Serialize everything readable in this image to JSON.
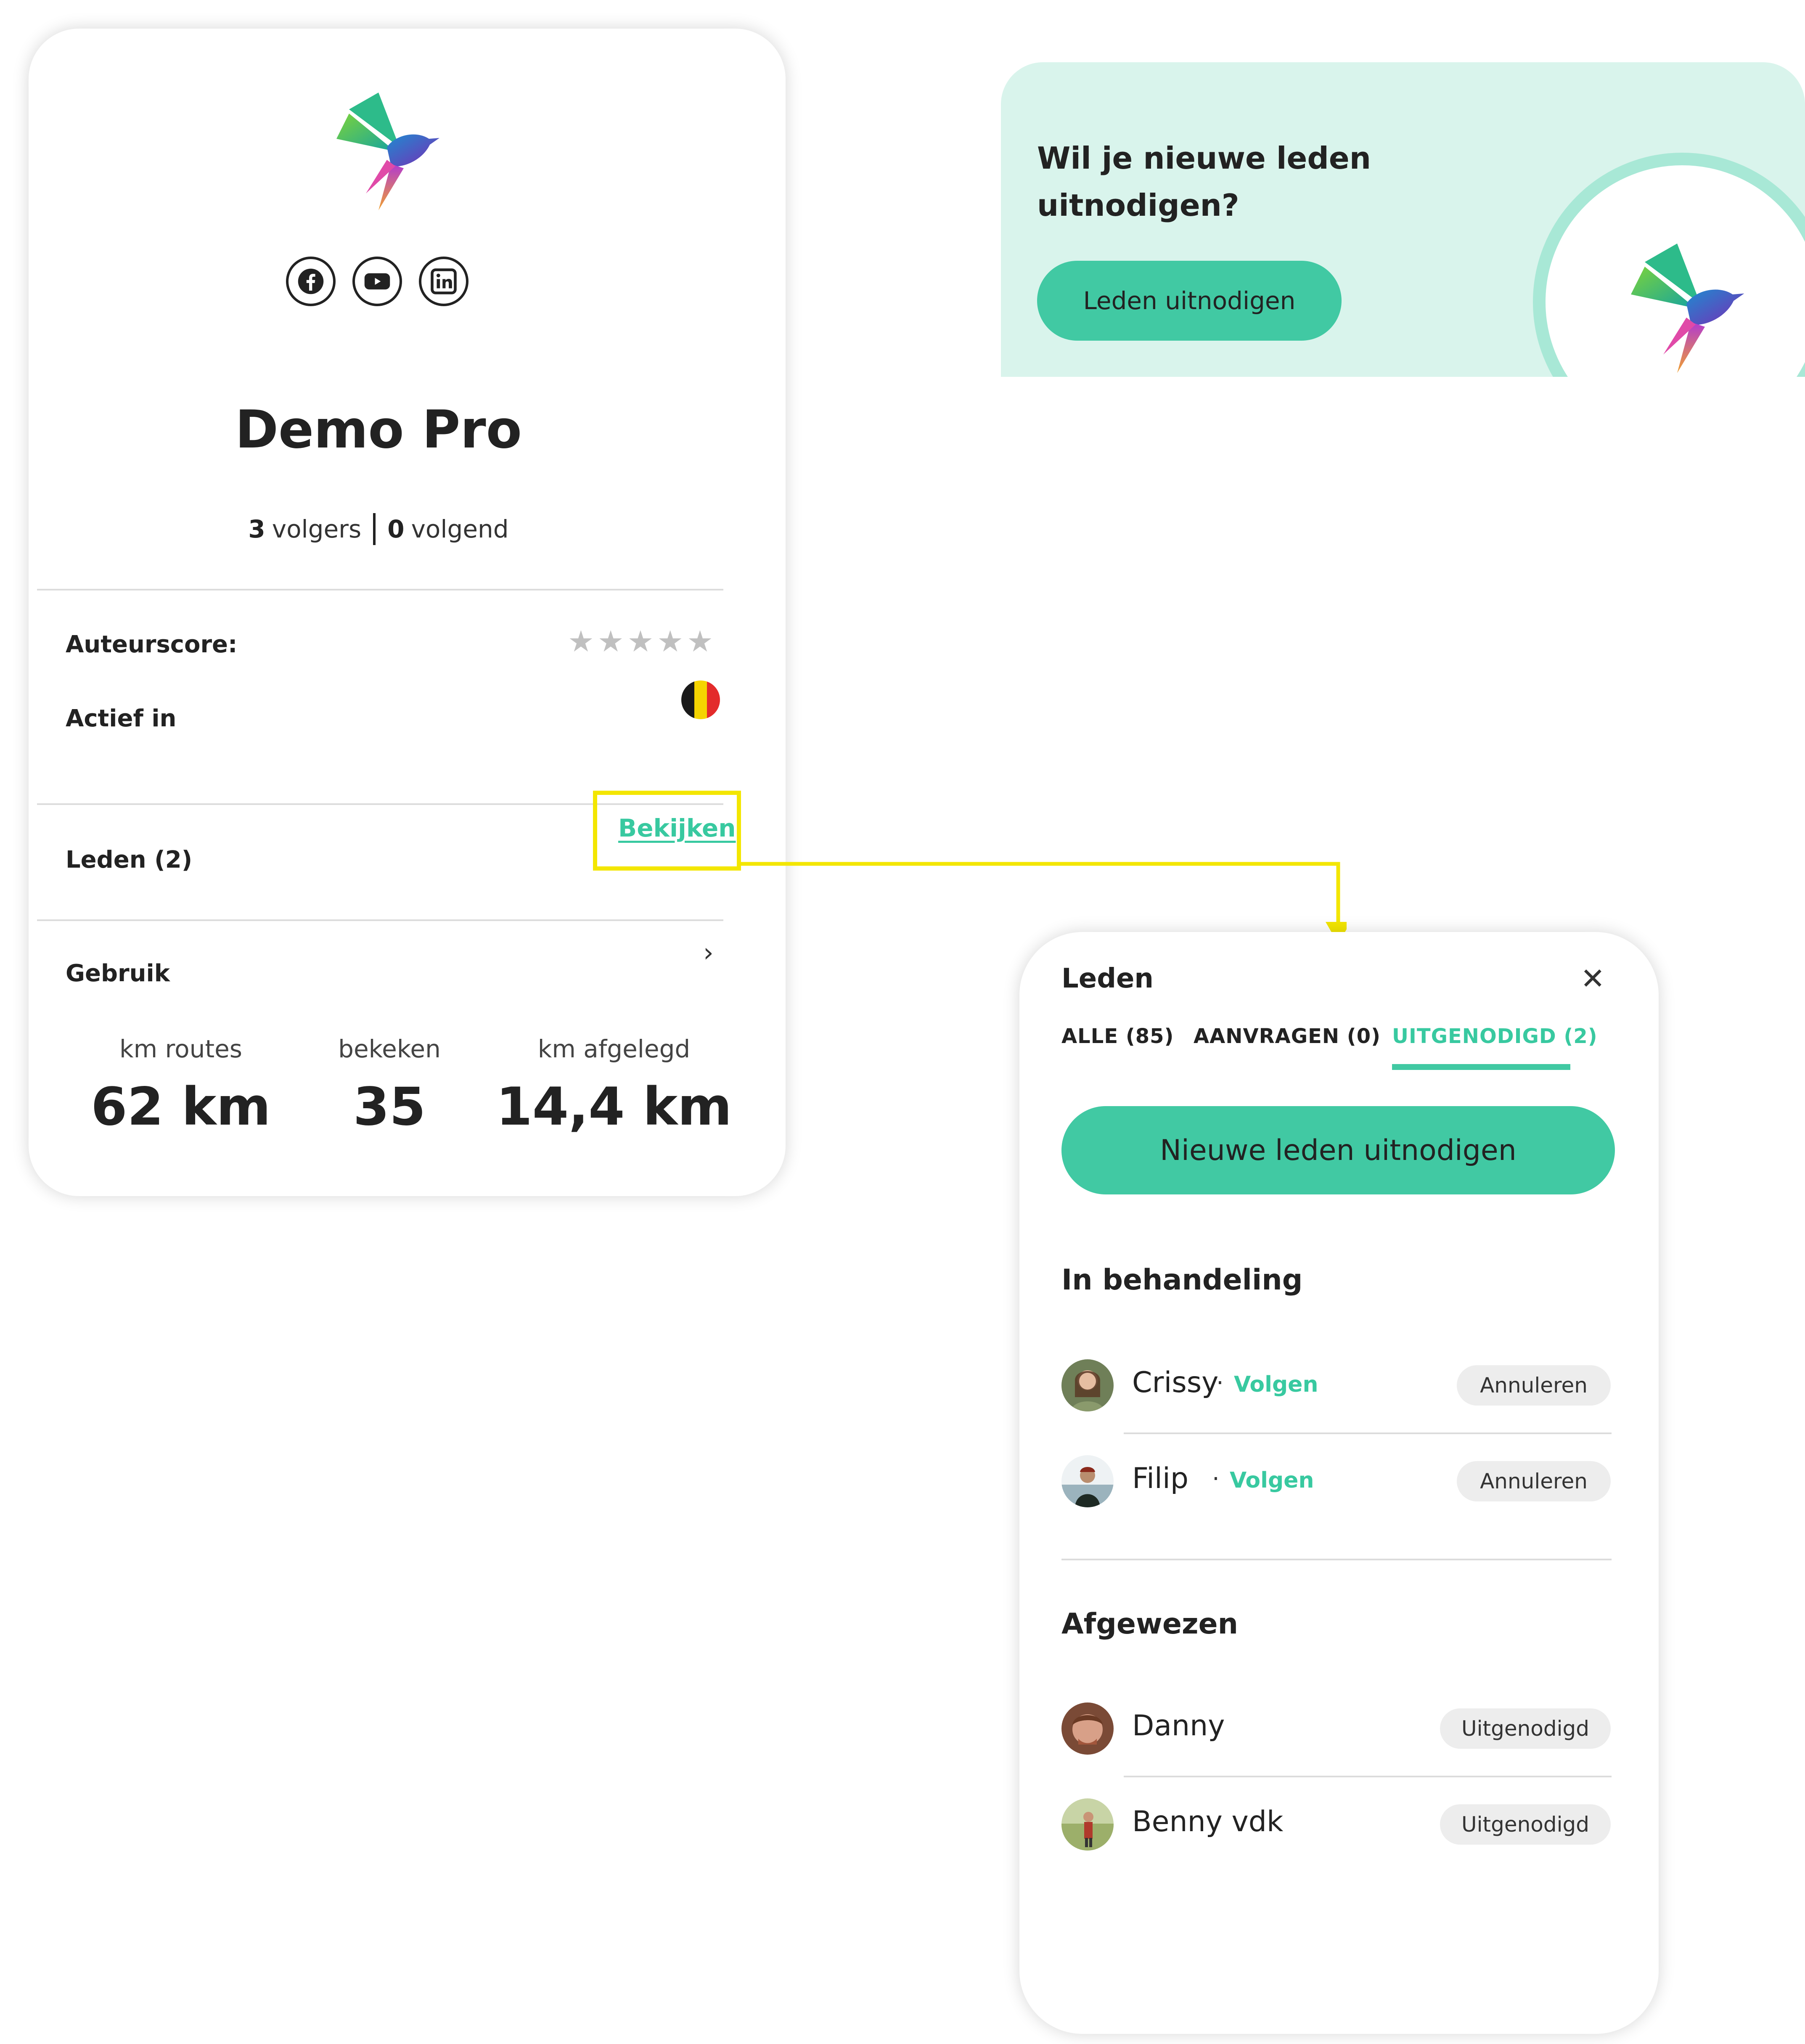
{
  "profile": {
    "name": "Demo Pro",
    "followers_count": "3",
    "followers_label": "volgers",
    "following_count": "0",
    "following_label": "volgend",
    "social_icons": [
      "facebook-icon",
      "youtube-icon",
      "linkedin-icon"
    ],
    "author_score_label": "Auteurscore:",
    "author_score_stars": 0,
    "author_score_max": 5,
    "active_in_label": "Actief in",
    "active_country_flag": "belgium-flag-icon",
    "members_label": "Leden (2)",
    "members_link": "Bekijken",
    "usage_label": "Gebruik",
    "stats": [
      {
        "label": "km routes",
        "value": "62 km"
      },
      {
        "label": "bekeken",
        "value": "35"
      },
      {
        "label": "km afgelegd",
        "value": "14,4 km"
      }
    ]
  },
  "invite_banner": {
    "title_line1": "Wil je nieuwe leden",
    "title_line2": "uitnodigen?",
    "button": "Leden uitnodigen"
  },
  "members_panel": {
    "title": "Leden",
    "tabs": [
      {
        "label": "ALLE (85)",
        "active": false
      },
      {
        "label": "AANVRAGEN (0)",
        "active": false
      },
      {
        "label": "UITGENODIGD (2)",
        "active": true
      }
    ],
    "invite_button": "Nieuwe leden uitnodigen",
    "pending": {
      "heading": "In behandeling",
      "members": [
        {
          "name": "Crissy",
          "follow": "Volgen",
          "action": "Annuleren"
        },
        {
          "name": "Filip",
          "follow": "Volgen",
          "action": "Annuleren"
        }
      ]
    },
    "declined": {
      "heading": "Afgewezen",
      "members": [
        {
          "name": "Danny",
          "status": "Uitgenodigd"
        },
        {
          "name": "Benny vdk",
          "status": "Uitgenodigd"
        }
      ]
    },
    "separator_dot": "·"
  },
  "colors": {
    "accent": "#41c9a3",
    "accent_text": "#38c9a0",
    "banner_bg": "#d9f4ec",
    "highlight": "#f3e600"
  }
}
